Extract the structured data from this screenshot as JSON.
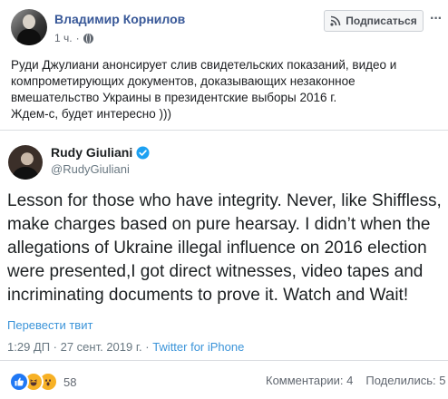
{
  "post": {
    "author": "Владимир Корнилов",
    "time": "1 ч.",
    "subscribe_label": "Подписаться",
    "more_label": "···",
    "text_lines": [
      "Руди Джулиани анонсирует слив свидетельских показаний, видео и",
      "компрометирующих документов, доказывающих незаконное",
      "вмешательство Украины в президентские выборы 2016 г.",
      "Ждем-с, будет интересно )))"
    ]
  },
  "tweet": {
    "name": "Rudy Giuliani",
    "handle": "@RudyGiuliani",
    "text_lines": [
      "Lesson for those who have integrity. Never, like Shiffless,",
      "make charges based on pure hearsay. I didn’t when the",
      "allegations of Ukraine illegal influence on 2016 election",
      "were presented,I got direct witnesses, video tapes and",
      "incriminating documents to prove it. Watch and Wait!"
    ],
    "translate_label": "Перевести твит",
    "timestamp": "1:29 ДП · 27 сент. 2019 г. · ",
    "platform": "Twitter for iPhone"
  },
  "footer": {
    "reaction_count": "58",
    "comments": "Комментарии: 4",
    "shares": "Поделились: 5"
  },
  "colors": {
    "link_blue": "#385898",
    "twitter_blue": "#3b94d9",
    "like_blue": "#2078f4",
    "emoji_yellow": "#f7b125"
  },
  "icons": [
    "globe-icon",
    "rss-icon",
    "more-icon",
    "verified-icon",
    "like-reaction-icon",
    "haha-reaction-icon",
    "wow-reaction-icon"
  ]
}
